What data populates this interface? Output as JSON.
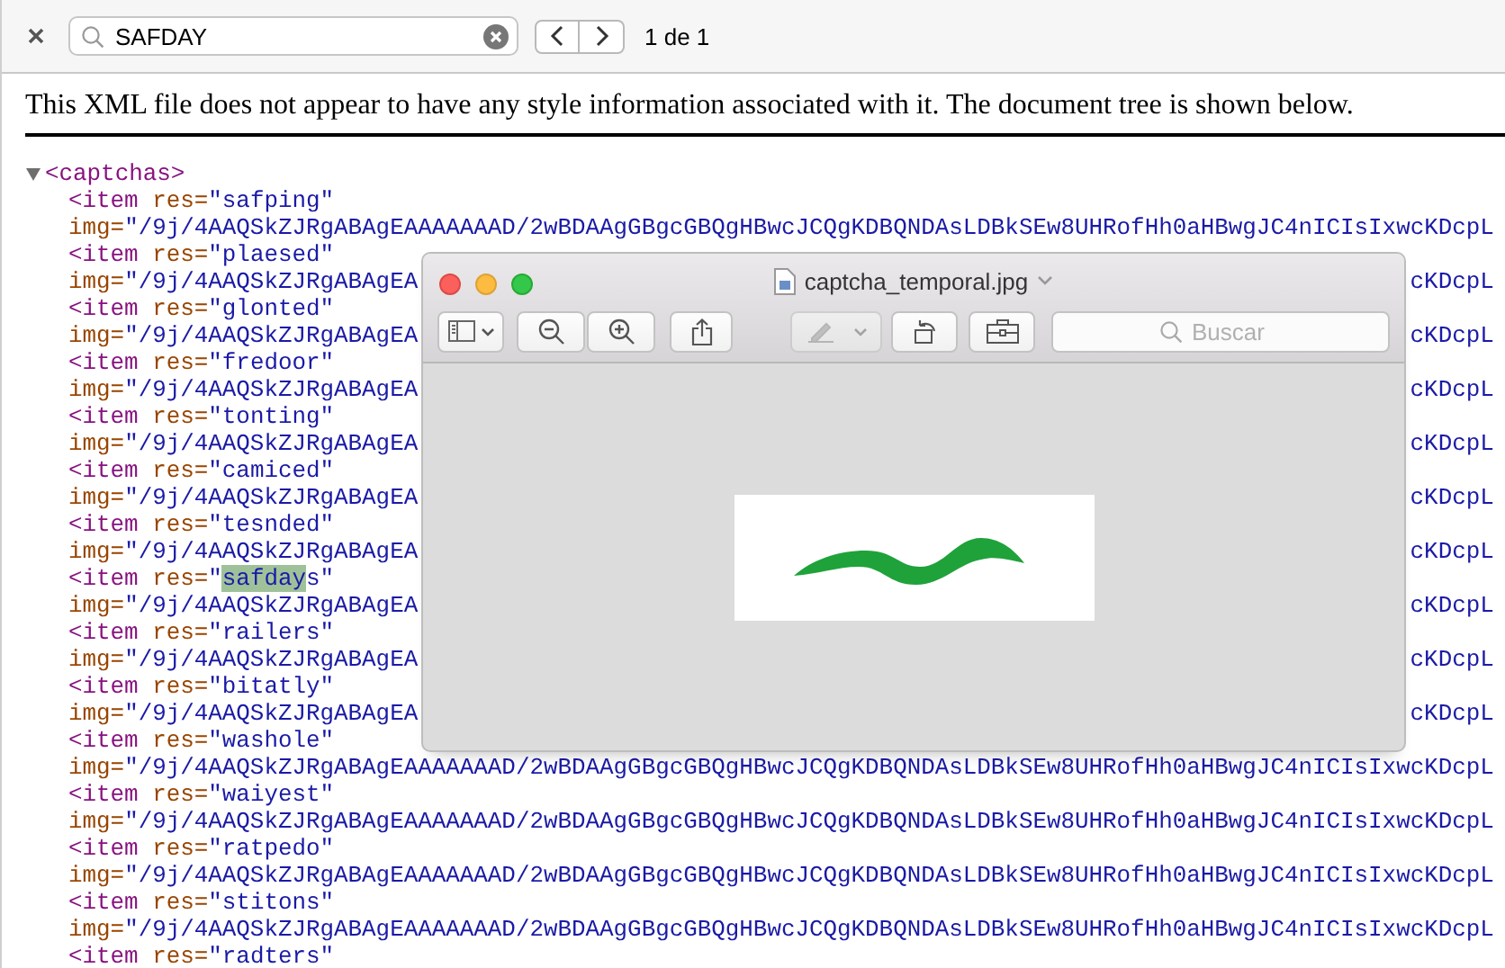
{
  "find_bar": {
    "query": "SAFDAY",
    "result": "1 de 1"
  },
  "notice": "This XML file does not appear to have any style information associated with it. The document tree is shown below.",
  "xml": {
    "root": "<captchas>",
    "expanded": true,
    "lines": [
      {
        "tokens": [
          {
            "kind": "tag",
            "text": "<item"
          },
          {
            "kind": "attr",
            "text": " res="
          },
          {
            "kind": "value",
            "text": "\"safping\""
          }
        ]
      },
      {
        "tokens": [
          {
            "kind": "attr",
            "text": "img="
          },
          {
            "kind": "value",
            "text": "\"/9j/4AAQSkZJRgABAgEAAAAAAAD/2wBDAAgGBgcGBQgHBwcJCQgKDBQNDAsLDBkSEw8UHRofHh0aHBwgJC4nICIsIxwcKDcpL"
          }
        ]
      },
      {
        "tokens": [
          {
            "kind": "tag",
            "text": "<item"
          },
          {
            "kind": "attr",
            "text": " res="
          },
          {
            "kind": "value",
            "text": "\"plaesed\""
          }
        ]
      },
      {
        "tokens": [
          {
            "kind": "attr",
            "text": "img="
          },
          {
            "kind": "value",
            "text": "\"/9j/4AAQSkZJRgABAgEA"
          }
        ],
        "tail": "cKDcpL"
      },
      {
        "tokens": [
          {
            "kind": "tag",
            "text": "<item"
          },
          {
            "kind": "attr",
            "text": " res="
          },
          {
            "kind": "value",
            "text": "\"glonted\""
          }
        ]
      },
      {
        "tokens": [
          {
            "kind": "attr",
            "text": "img="
          },
          {
            "kind": "value",
            "text": "\"/9j/4AAQSkZJRgABAgEA"
          }
        ],
        "tail": "cKDcpL"
      },
      {
        "tokens": [
          {
            "kind": "tag",
            "text": "<item"
          },
          {
            "kind": "attr",
            "text": " res="
          },
          {
            "kind": "value",
            "text": "\"fredoor\""
          }
        ]
      },
      {
        "tokens": [
          {
            "kind": "attr",
            "text": "img="
          },
          {
            "kind": "value",
            "text": "\"/9j/4AAQSkZJRgABAgEA"
          }
        ],
        "tail": "cKDcpL"
      },
      {
        "tokens": [
          {
            "kind": "tag",
            "text": "<item"
          },
          {
            "kind": "attr",
            "text": " res="
          },
          {
            "kind": "value",
            "text": "\"tonting\""
          }
        ]
      },
      {
        "tokens": [
          {
            "kind": "attr",
            "text": "img="
          },
          {
            "kind": "value",
            "text": "\"/9j/4AAQSkZJRgABAgEA"
          }
        ],
        "tail": "cKDcpL"
      },
      {
        "tokens": [
          {
            "kind": "tag",
            "text": "<item"
          },
          {
            "kind": "attr",
            "text": " res="
          },
          {
            "kind": "value",
            "text": "\"camiced\""
          }
        ]
      },
      {
        "tokens": [
          {
            "kind": "attr",
            "text": "img="
          },
          {
            "kind": "value",
            "text": "\"/9j/4AAQSkZJRgABAgEA"
          }
        ],
        "tail": "cKDcpL"
      },
      {
        "tokens": [
          {
            "kind": "tag",
            "text": "<item"
          },
          {
            "kind": "attr",
            "text": " res="
          },
          {
            "kind": "value",
            "text": "\"tesnded\""
          }
        ]
      },
      {
        "tokens": [
          {
            "kind": "attr",
            "text": "img="
          },
          {
            "kind": "value",
            "text": "\"/9j/4AAQSkZJRgABAgEA"
          }
        ],
        "tail": "cKDcpL"
      },
      {
        "tokens": [
          {
            "kind": "tag",
            "text": "<item"
          },
          {
            "kind": "attr",
            "text": " res="
          },
          {
            "kind": "value",
            "text": "\""
          },
          {
            "kind": "match",
            "text": "safday"
          },
          {
            "kind": "value",
            "text": "s\""
          }
        ]
      },
      {
        "tokens": [
          {
            "kind": "attr",
            "text": "img="
          },
          {
            "kind": "value",
            "text": "\"/9j/4AAQSkZJRgABAgEA"
          }
        ],
        "tail": "cKDcpL"
      },
      {
        "tokens": [
          {
            "kind": "tag",
            "text": "<item"
          },
          {
            "kind": "attr",
            "text": " res="
          },
          {
            "kind": "value",
            "text": "\"railers\""
          }
        ]
      },
      {
        "tokens": [
          {
            "kind": "attr",
            "text": "img="
          },
          {
            "kind": "value",
            "text": "\"/9j/4AAQSkZJRgABAgEA"
          }
        ],
        "tail": "cKDcpL"
      },
      {
        "tokens": [
          {
            "kind": "tag",
            "text": "<item"
          },
          {
            "kind": "attr",
            "text": " res="
          },
          {
            "kind": "value",
            "text": "\"bitatly\""
          }
        ]
      },
      {
        "tokens": [
          {
            "kind": "attr",
            "text": "img="
          },
          {
            "kind": "value",
            "text": "\"/9j/4AAQSkZJRgABAgEA"
          }
        ],
        "tail": "cKDcpL"
      },
      {
        "tokens": [
          {
            "kind": "tag",
            "text": "<item"
          },
          {
            "kind": "attr",
            "text": " res="
          },
          {
            "kind": "value",
            "text": "\"washole\""
          }
        ]
      },
      {
        "tokens": [
          {
            "kind": "attr",
            "text": "img="
          },
          {
            "kind": "value",
            "text": "\"/9j/4AAQSkZJRgABAgEAAAAAAAD/2wBDAAgGBgcGBQgHBwcJCQgKDBQNDAsLDBkSEw8UHRofHh0aHBwgJC4nICIsIxwcKDcpL"
          }
        ]
      },
      {
        "tokens": [
          {
            "kind": "tag",
            "text": "<item"
          },
          {
            "kind": "attr",
            "text": " res="
          },
          {
            "kind": "value",
            "text": "\"waiyest\""
          }
        ]
      },
      {
        "tokens": [
          {
            "kind": "attr",
            "text": "img="
          },
          {
            "kind": "value",
            "text": "\"/9j/4AAQSkZJRgABAgEAAAAAAAD/2wBDAAgGBgcGBQgHBwcJCQgKDBQNDAsLDBkSEw8UHRofHh0aHBwgJC4nICIsIxwcKDcpL"
          }
        ]
      },
      {
        "tokens": [
          {
            "kind": "tag",
            "text": "<item"
          },
          {
            "kind": "attr",
            "text": " res="
          },
          {
            "kind": "value",
            "text": "\"ratpedo\""
          }
        ]
      },
      {
        "tokens": [
          {
            "kind": "attr",
            "text": "img="
          },
          {
            "kind": "value",
            "text": "\"/9j/4AAQSkZJRgABAgEAAAAAAAD/2wBDAAgGBgcGBQgHBwcJCQgKDBQNDAsLDBkSEw8UHRofHh0aHBwgJC4nICIsIxwcKDcpL"
          }
        ]
      },
      {
        "tokens": [
          {
            "kind": "tag",
            "text": "<item"
          },
          {
            "kind": "attr",
            "text": " res="
          },
          {
            "kind": "value",
            "text": "\"stitons\""
          }
        ]
      },
      {
        "tokens": [
          {
            "kind": "attr",
            "text": "img="
          },
          {
            "kind": "value",
            "text": "\"/9j/4AAQSkZJRgABAgEAAAAAAAD/2wBDAAgGBgcGBQgHBwcJCQgKDBQNDAsLDBkSEw8UHRofHh0aHBwgJC4nICIsIxwcKDcpL"
          }
        ]
      },
      {
        "tokens": [
          {
            "kind": "tag",
            "text": "<item"
          },
          {
            "kind": "attr",
            "text": " res="
          },
          {
            "kind": "value",
            "text": "\"radters\""
          }
        ]
      }
    ]
  },
  "preview_window": {
    "title": "captcha_temporal.jpg",
    "search": {
      "placeholder": "Buscar"
    },
    "markup_disabled": true
  }
}
